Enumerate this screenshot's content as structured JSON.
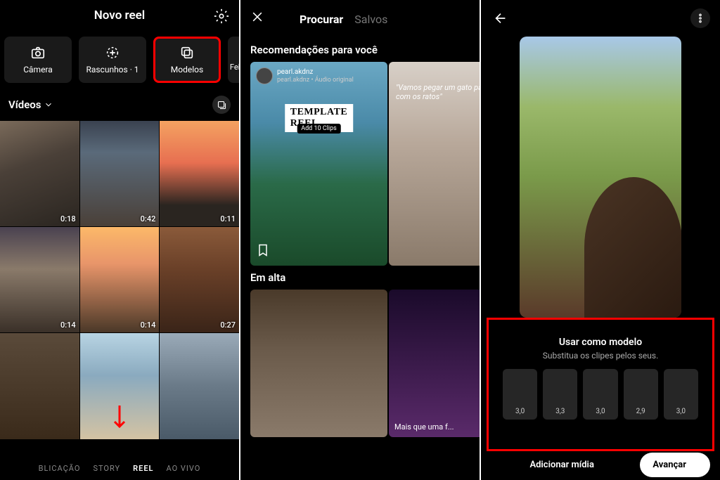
{
  "screen1": {
    "title": "Novo reel",
    "tabs": {
      "camera": "Câmera",
      "drafts": "Rascunhos · 1",
      "templates": "Modelos",
      "made": "Feito"
    },
    "section_label": "Vídeos",
    "durations": [
      "0:18",
      "0:42",
      "0:11",
      "0:14",
      "0:14",
      "0:27"
    ],
    "bottom_tabs": {
      "post": "BLICAÇÃO",
      "story": "STORY",
      "reel": "REEL",
      "live": "AO VIVO"
    }
  },
  "screen2": {
    "tabs": {
      "search": "Procurar",
      "saved": "Salvos"
    },
    "rec_title": "Recomendações para você",
    "reel1": {
      "author": "pearl.akdnz",
      "audio": "pearl.akdnz • Áudio original",
      "overlay": "TEMPLATE REEL",
      "overlay_sub": "Add 10 Clips"
    },
    "reel2": {
      "quote": "\"Vamos pegar um gato para acabar com os ratos\""
    },
    "trending_title": "Em alta",
    "reel4_caption": "Mais que uma f..."
  },
  "screen3": {
    "panel_title": "Usar como modelo",
    "panel_sub": "Substitua os clipes pelos seus.",
    "clips": [
      "3,0",
      "3,3",
      "3,0",
      "2,9",
      "3,0"
    ],
    "add_media": "Adicionar mídia",
    "next": "Avançar"
  }
}
